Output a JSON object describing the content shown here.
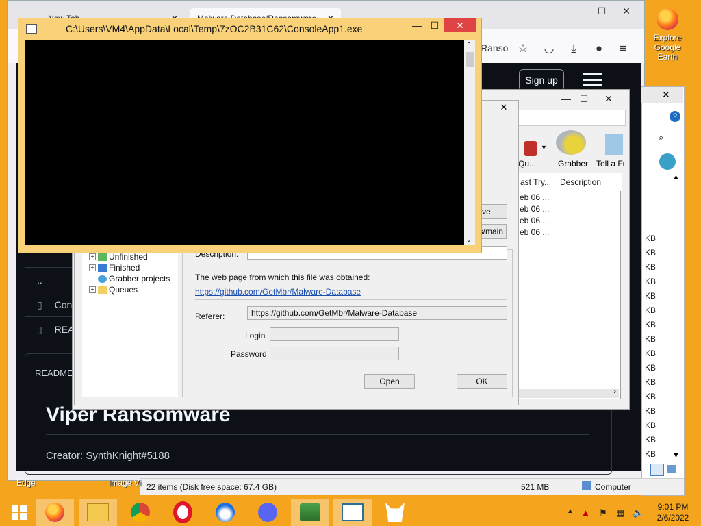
{
  "desktop": {
    "icon_label": "Explore Google Earth",
    "bottom_labels": [
      "Edge",
      "Image Vi"
    ]
  },
  "firefox": {
    "tabs": [
      "New Tab",
      "Malware Database/Ransomware"
    ],
    "url_tail": "Ranso",
    "github": {
      "signup": "Sign up",
      "rows": [
        "..",
        "Con",
        "REA"
      ],
      "readme_label": "README",
      "heading": "Viper Ransomware",
      "creator": "Creator: SynthKnight#5188"
    }
  },
  "idm": {
    "toolbar": {
      "queues": "Qu...",
      "grabber": "Grabber",
      "tell": "Tell a Fri"
    },
    "columns": [
      "ast Try...",
      "Description"
    ],
    "rows": [
      "eb 06 ...",
      "eb 06 ...",
      "eb 06 ...",
      "eb 06 ..."
    ],
    "partial_buttons": [
      "ve",
      "ds/main"
    ]
  },
  "props": {
    "tree": [
      "Unfinished",
      "Finished",
      "Grabber projects",
      "Queues"
    ],
    "description_label": "Description:",
    "source_label": "The web page from which this file was obtained:",
    "source_link": "https://github.com/GetMbr/Malware-Database",
    "referer_label": "Referer:",
    "referer_value": "https://github.com/GetMbr/Malware-Database",
    "login_label": "Login",
    "password_label": "Password",
    "open_btn": "Open",
    "ok_btn": "OK"
  },
  "console": {
    "title": "C:\\Users\\VM4\\AppData\\Local\\Temp\\7zOC2B31C62\\ConsoleApp1.exe"
  },
  "explorer": {
    "kb_label": "KB",
    "status_items": "22 items (Disk free space: 67.4 GB)",
    "status_size": "521 MB",
    "status_computer": "Computer"
  },
  "taskbar": {
    "time": "9:01 PM",
    "date": "2/6/2022"
  },
  "colors": {
    "desktop": "#f4a51d",
    "console_frame": "#f8d178",
    "github_bg": "#0d1117",
    "close_red": "#e04343"
  }
}
